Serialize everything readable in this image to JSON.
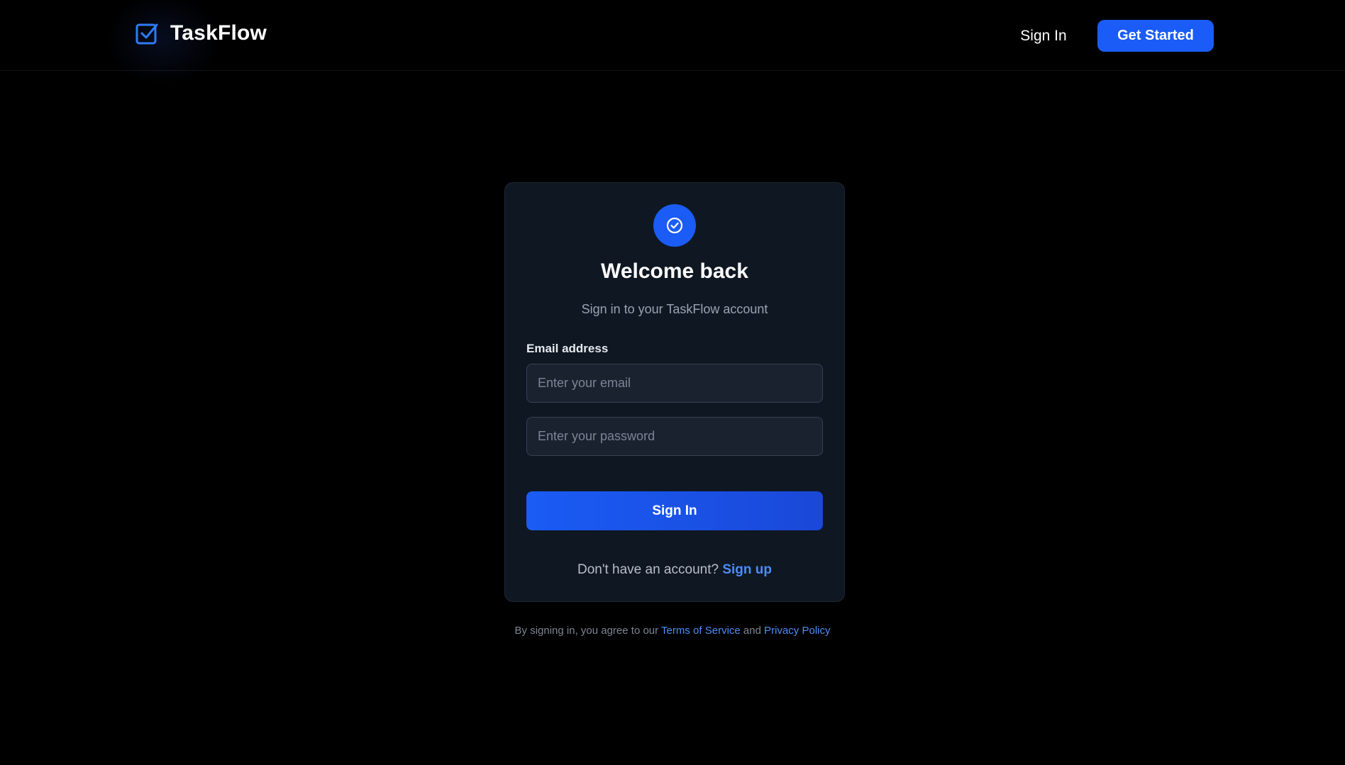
{
  "header": {
    "brand_name": "TaskFlow",
    "sign_in_label": "Sign In",
    "get_started_label": "Get Started"
  },
  "card": {
    "title": "Welcome back",
    "subtitle": "Sign in to your TaskFlow account",
    "email_label": "Email address",
    "email_placeholder": "Enter your email",
    "email_value": "",
    "password_placeholder": "Enter your password",
    "password_value": "",
    "submit_label": "Sign In",
    "signup_prompt": "Don't have an account?",
    "signup_link": "Sign up"
  },
  "legal": {
    "prefix": "By signing in, you agree to our",
    "terms_link": "Terms of Service",
    "conjunction": "and",
    "privacy_link": "Privacy Policy"
  },
  "icons": {
    "brand": "checkbox-icon",
    "card_logo": "check-circle-icon"
  },
  "colors": {
    "accent": "#1a5cf5",
    "link": "#4d8cf7",
    "background": "#000000",
    "card_background": "#0f1722"
  }
}
